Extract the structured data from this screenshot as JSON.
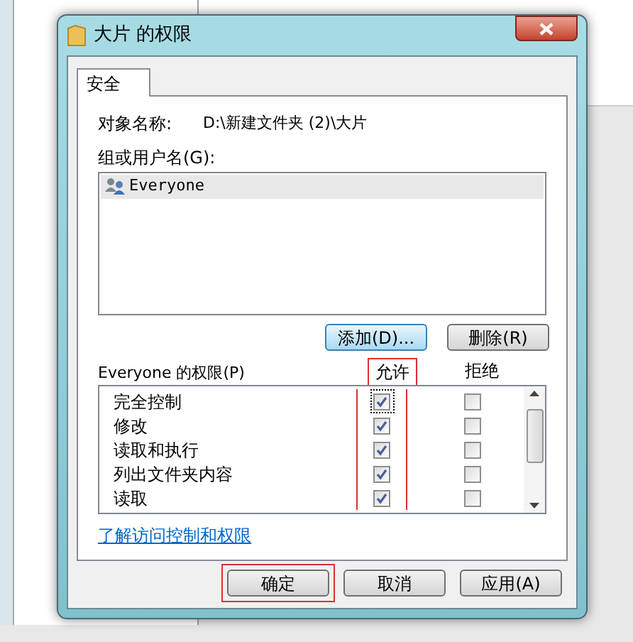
{
  "window": {
    "title": "大片 的权限"
  },
  "tabs": [
    {
      "label": "安全",
      "selected": true
    }
  ],
  "object_name": {
    "label": "对象名称:",
    "value": "D:\\新建文件夹 (2)\\大片"
  },
  "groups": {
    "label": "组或用户名(G):",
    "items": [
      {
        "name": "Everyone",
        "selected": true
      }
    ]
  },
  "group_buttons": [
    "添加(D)...",
    "删除(R)"
  ],
  "permissions": {
    "label": "Everyone 的权限(P)",
    "columns": [
      {
        "label": "允许",
        "highlighted": true
      },
      {
        "label": "拒绝",
        "highlighted": false
      }
    ],
    "rows": [
      {
        "name": "完全控制",
        "allow": true,
        "deny": false
      },
      {
        "name": "修改",
        "allow": true,
        "deny": false
      },
      {
        "name": "读取和执行",
        "allow": true,
        "deny": false
      },
      {
        "name": "列出文件夹内容",
        "allow": true,
        "deny": false
      },
      {
        "name": "读取",
        "allow": true,
        "deny": false
      }
    ]
  },
  "link": "了解访问控制和权限",
  "buttons": [
    {
      "label": "确定",
      "highlighted": true
    },
    {
      "label": "取消",
      "highlighted": false
    },
    {
      "label": "应用(A)",
      "highlighted": false
    }
  ]
}
